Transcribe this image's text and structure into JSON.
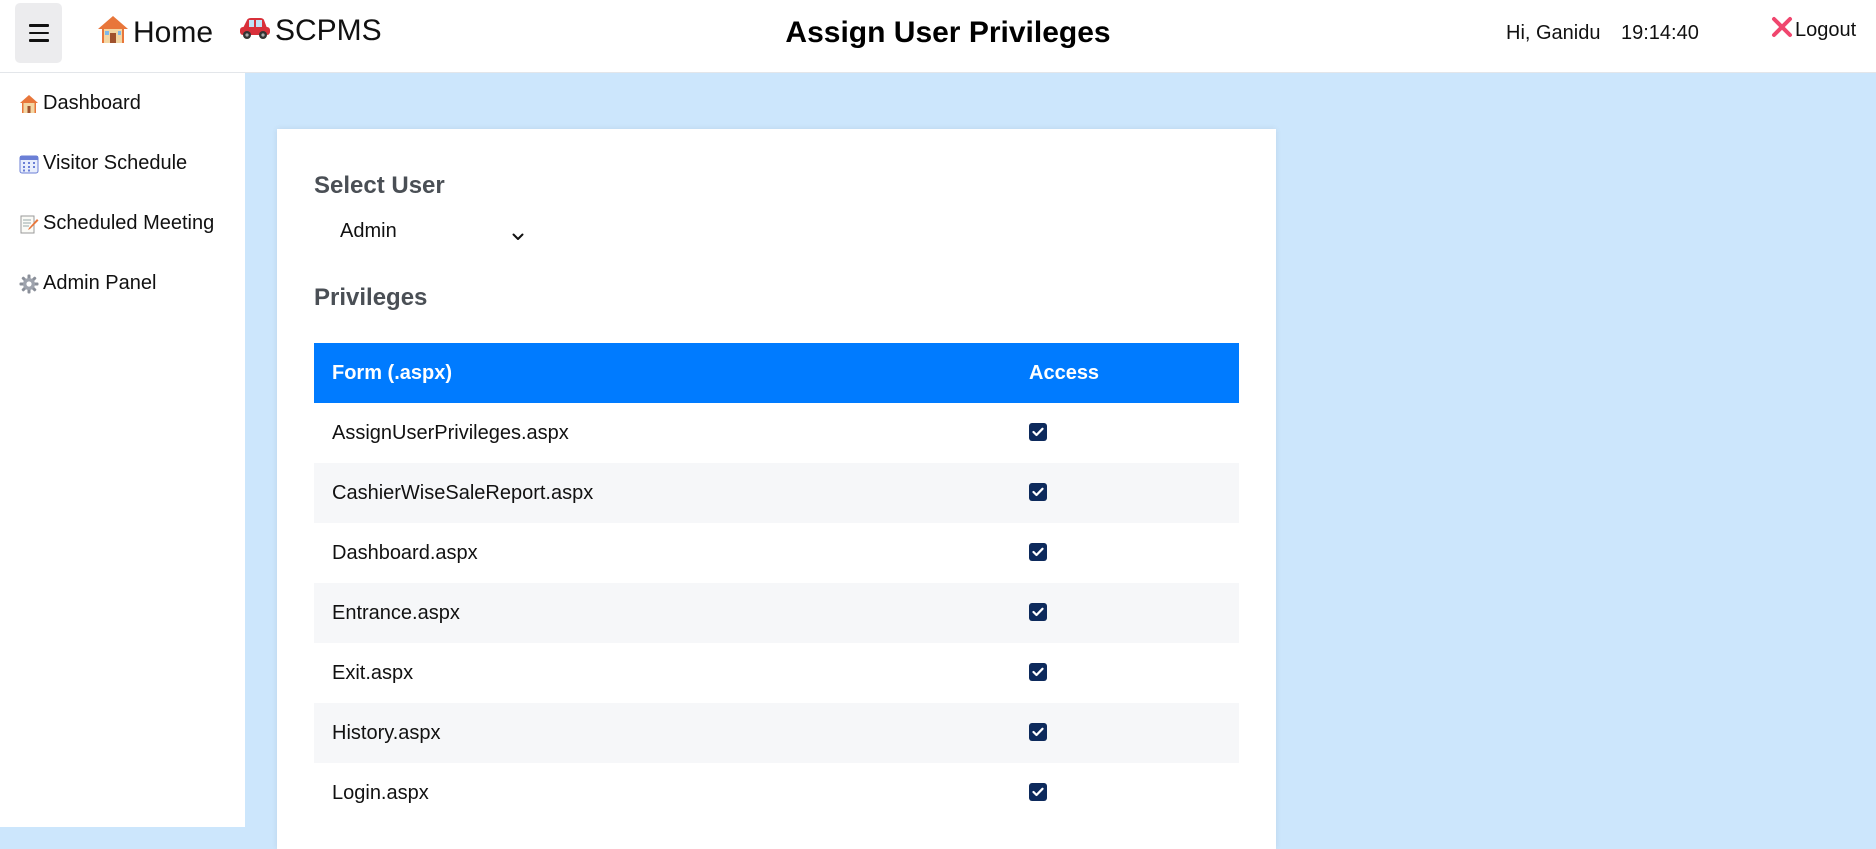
{
  "topbar": {
    "home_label": "Home",
    "app_label": "SCPMS",
    "page_title": "Assign User Privileges",
    "greeting": "Hi, Ganidu",
    "clock": "19:14:40",
    "logout_label": "Logout"
  },
  "sidebar": {
    "items": [
      {
        "label": "Dashboard",
        "icon": "house-icon"
      },
      {
        "label": "Visitor Schedule",
        "icon": "calendar-icon"
      },
      {
        "label": "Scheduled Meeting",
        "icon": "memo-icon"
      },
      {
        "label": "Admin Panel",
        "icon": "gear-icon"
      }
    ]
  },
  "main": {
    "select_user_label": "Select User",
    "selected_user": "Admin",
    "privileges_label": "Privileges",
    "table": {
      "headers": [
        "Form (.aspx)",
        "Access"
      ],
      "rows": [
        {
          "form": "AssignUserPrivileges.aspx",
          "access": true
        },
        {
          "form": "CashierWiseSaleReport.aspx",
          "access": true
        },
        {
          "form": "Dashboard.aspx",
          "access": true
        },
        {
          "form": "Entrance.aspx",
          "access": true
        },
        {
          "form": "Exit.aspx",
          "access": true
        },
        {
          "form": "History.aspx",
          "access": true
        },
        {
          "form": "Login.aspx",
          "access": true
        }
      ]
    }
  },
  "colors": {
    "page_background": "#cce6fc",
    "table_header": "#007bff",
    "checkbox": "#0d2a5c",
    "logout_x": "#f0466e"
  }
}
